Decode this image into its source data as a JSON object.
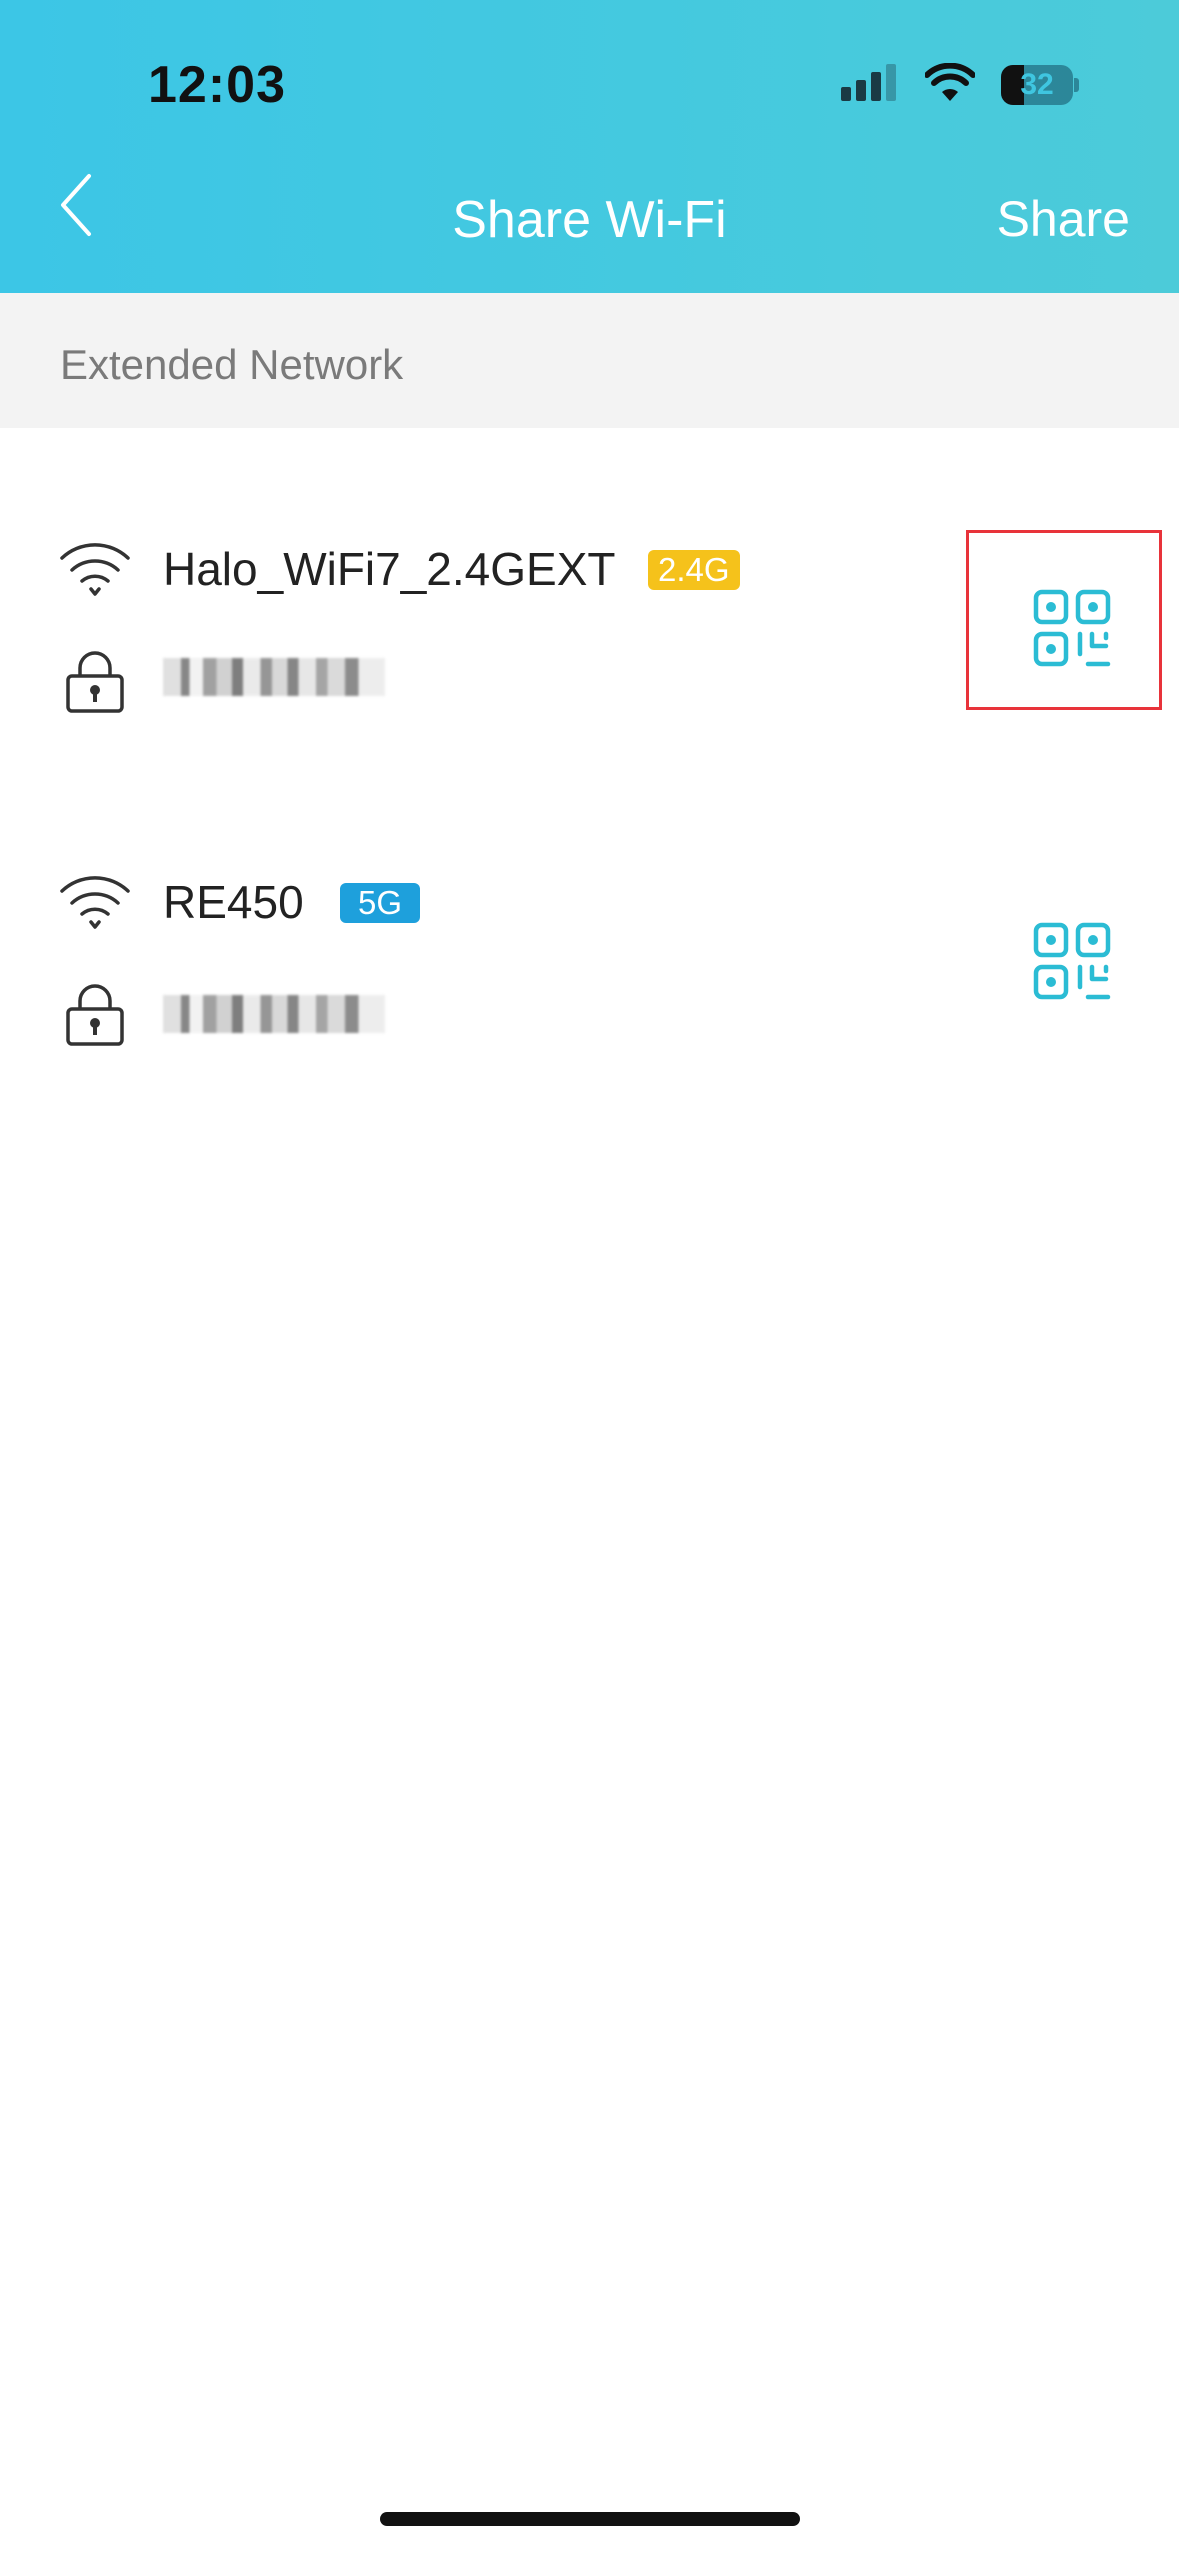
{
  "status_bar": {
    "time": "12:03",
    "battery": "32",
    "battery_fraction": 0.32,
    "icons": [
      "cellular-signal-icon",
      "wifi-icon",
      "battery-icon"
    ]
  },
  "nav": {
    "back_icon": "chevron-left-icon",
    "title": "Share Wi-Fi",
    "share_label": "Share"
  },
  "section": {
    "title": "Extended Network"
  },
  "networks": [
    {
      "ssid": "Halo_WiFi7_2.4GEXT",
      "band": "2.4G",
      "band_color": "#f5c21b",
      "password_masked": true,
      "qr_icon": "qr-code-icon"
    },
    {
      "ssid": "RE450",
      "band": "5G",
      "band_color": "#1ea0dc",
      "password_masked": true,
      "qr_icon": "qr-code-icon"
    }
  ],
  "colors": {
    "header_gradient_start": "#3cc6e6",
    "header_gradient_end": "#4ccbd9",
    "accent": "#2bbcd4",
    "highlight": "#e8333a"
  }
}
